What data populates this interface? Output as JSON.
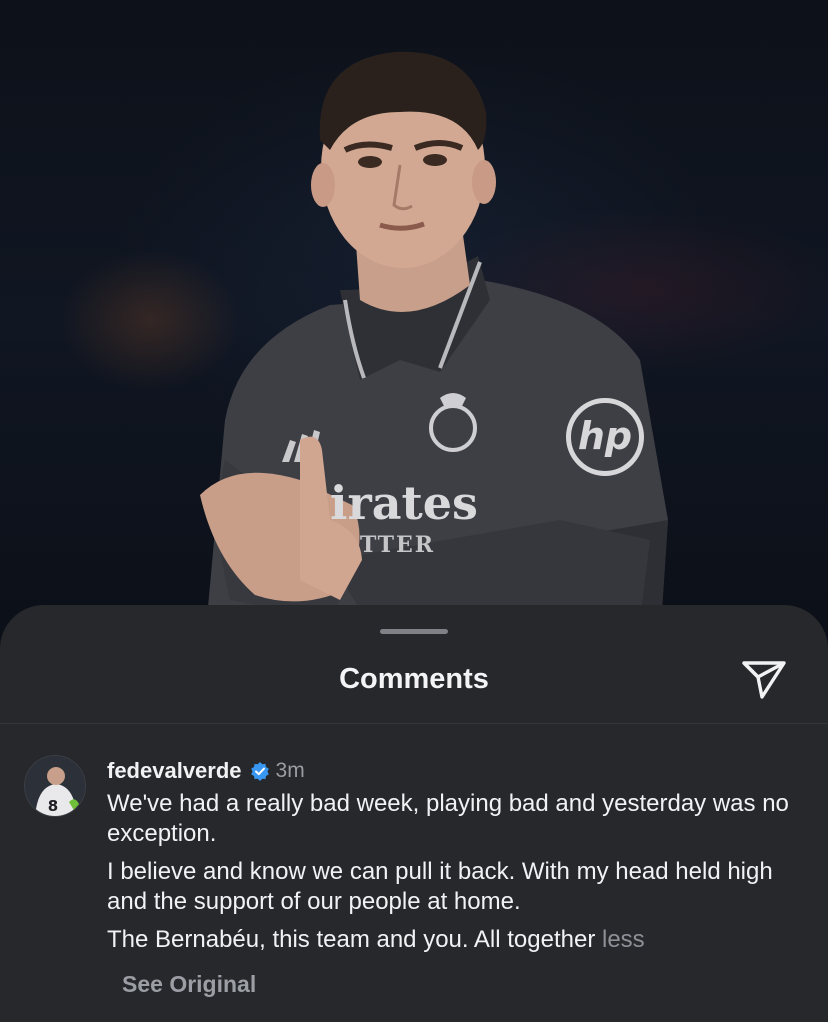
{
  "post": {
    "shirt_sponsor": "irates",
    "shirt_sponsor_sub": "TTER",
    "sleeve_logo": "hp"
  },
  "sheet": {
    "title": "Comments",
    "share_icon": "paper-plane-icon"
  },
  "comment": {
    "username": "fedevalverde",
    "verified": true,
    "time": "3m",
    "avatar_number": "8",
    "paragraphs": [
      "We've had a really bad week, playing bad and yesterday was no exception.",
      "I believe and know we can pull it back. With my head held high and the support of our people at home.",
      "The Bernabéu, this team and you. All together"
    ],
    "less_label": "less",
    "see_original_label": "See Original"
  },
  "colors": {
    "sheet_bg": "#26282c",
    "verified_blue": "#3897f0",
    "muted_text": "#9a9ca2"
  }
}
